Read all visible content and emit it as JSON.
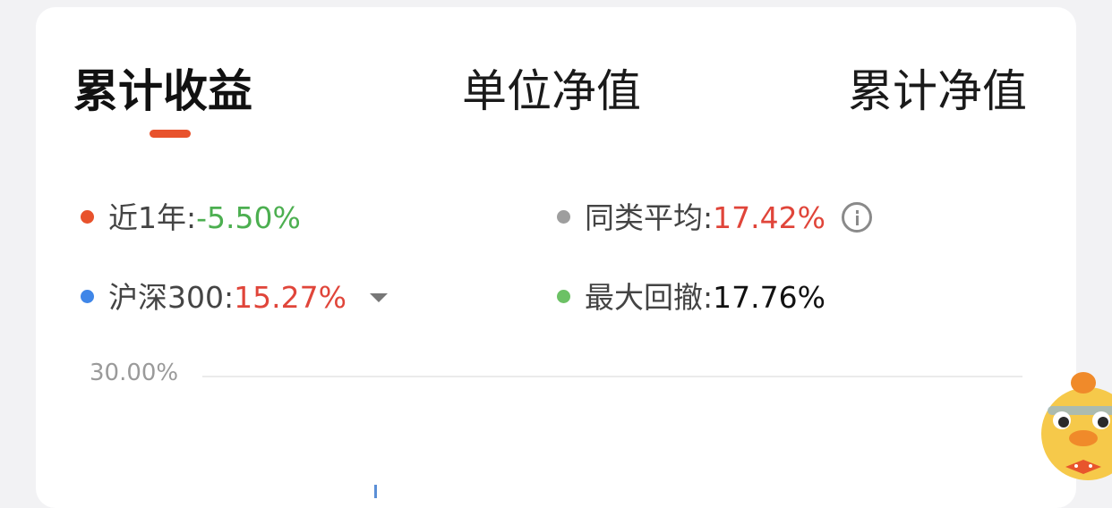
{
  "tabs": [
    {
      "label": "累计收益",
      "active": true
    },
    {
      "label": "单位净值",
      "active": false
    },
    {
      "label": "累计净值",
      "active": false
    }
  ],
  "metrics": {
    "recent_year": {
      "label": "近1年:",
      "value": "-5.50%",
      "dot_color": "#e8522c",
      "value_color": "#4caf50"
    },
    "peer_avg": {
      "label": "同类平均:",
      "value": "17.42%",
      "dot_color": "#9e9e9e",
      "value_color": "#e0453a"
    },
    "benchmark": {
      "label": "沪深300:",
      "value": "15.27%",
      "dot_color": "#3f86e8",
      "value_color": "#e0453a"
    },
    "max_drawdown": {
      "label": "最大回撤:",
      "value": "17.76%",
      "dot_color": "#6cc165",
      "value_color": "#111111"
    }
  },
  "chart": {
    "y_axis_top_label": "30.00%"
  },
  "icons": {
    "info": "info-icon",
    "dropdown": "caret-down-icon",
    "assistant": "duck-mascot-icon"
  }
}
